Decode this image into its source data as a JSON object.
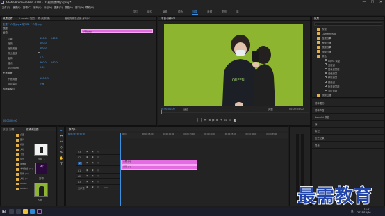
{
  "window": {
    "title": "Adobe Premiere Pro 2020 - D:\\视频\\剪辑.prproj *",
    "buttons": [
      "—",
      "□",
      "✕"
    ]
  },
  "menu": [
    "文件(F)",
    "编辑(E)",
    "剪辑(C)",
    "序列(S)",
    "标记(M)",
    "图形(G)",
    "视图(V)",
    "窗口(W)",
    "帮助(H)"
  ],
  "workspaces": [
    {
      "label": "学习",
      "active": false
    },
    {
      "label": "组件",
      "active": false
    },
    {
      "label": "编辑",
      "active": false
    },
    {
      "label": "颜色",
      "active": false
    },
    {
      "label": "效果",
      "active": true
    },
    {
      "label": "音频",
      "active": false
    },
    {
      "label": "图形",
      "active": false
    },
    {
      "label": "库",
      "active": false
    }
  ],
  "effect_controls": {
    "tabs": [
      "效果控件",
      "Lumetri 范围",
      "源:(无剪辑)",
      "音频剪辑混合器:序列01"
    ],
    "source_path": "主要 * 人物.jpg ▸ 序列01 * 人物.jpg",
    "video_header": "视频",
    "sections": [
      {
        "label": "运动",
        "bold": true
      },
      {
        "label": "位置",
        "value": "360.0",
        "value2": "240.0"
      },
      {
        "label": "缩放",
        "value": "100.0"
      },
      {
        "label": "缩放宽度",
        "value": "100.0"
      },
      {
        "label": "等比缩放",
        "checkbox": true
      },
      {
        "label": "旋转",
        "value": "0.0"
      },
      {
        "label": "锚点",
        "value": "360.0",
        "value2": "240.0"
      },
      {
        "label": "防闪烁滤镜",
        "value": "0.00"
      },
      {
        "label": "不透明度",
        "bold": true
      },
      {
        "label": "不透明度",
        "value": "100.0 %"
      },
      {
        "label": "混合模式",
        "value": "正常"
      },
      {
        "label": "时间重映射",
        "bold": true
      }
    ],
    "clip_label": "人物.jpg",
    "timecode": "00:00:00:00"
  },
  "program_monitor": {
    "title": "节目: 序列01",
    "timecode_left": "00:00:00:00",
    "fit_label": "适合",
    "quality_label": "完整",
    "timecode_right": "00:00:05:00",
    "bg_color": "#8db52f"
  },
  "effects_panel": {
    "title": "效果",
    "categories": [
      "预设",
      "Lumetri 预设",
      "音频效果",
      "音频过渡",
      "视频效果",
      "视频过渡",
      "颜色"
    ],
    "open_category_index": 6,
    "items": [
      "Alpha 调整",
      "亮度键",
      "图像遮罩键",
      "差值遮罩",
      "移除遮罩",
      "超级键",
      "轨道遮罩键",
      "非红色键"
    ],
    "more_categories": [
      "视频过渡"
    ],
    "side_sections": [
      "基本图形",
      "基本声音",
      "Lumetri 颜色",
      "库",
      "标记",
      "历史记录",
      "信息"
    ]
  },
  "project_panel": {
    "tabs": [
      "项目: 剪辑",
      "媒体浏览器"
    ],
    "tree": [
      "桌面",
      "图片",
      "视频",
      "文档",
      "下载",
      "音乐",
      "此电脑",
      "本地磁盘 (C:)",
      "软件 (D:)",
      "文档 (E:)",
      "Adobe",
      "Adobe P"
    ],
    "thumbs": [
      {
        "label": "视频_1",
        "type": "video"
      },
      {
        "label": "剪辑",
        "type": "premiere"
      },
      {
        "label": "人物",
        "type": "photo"
      }
    ]
  },
  "tools": [
    "▸",
    "⇔",
    "⇿",
    "◇",
    "✎",
    "✋",
    "T"
  ],
  "timeline": {
    "title": "序列01",
    "timecode": "00:00:00:00",
    "ruler_labels": [
      "00:00",
      "00:00:05:00",
      "00:00:10:00",
      "00:00:15:00",
      "00:00:20:00",
      "00:00:25:00",
      "00:00:30:00",
      "00:00:35:00"
    ],
    "tracks": [
      {
        "name": "V3"
      },
      {
        "name": "V2"
      },
      {
        "name": "V1",
        "active": true
      },
      {
        "name": "A1"
      },
      {
        "name": "A2"
      },
      {
        "name": "A3"
      },
      {
        "name": "主声道",
        "value": "0.0"
      }
    ],
    "clips": [
      {
        "label": "人物.jpg",
        "track": "V2"
      },
      {
        "label": "背景.jpg",
        "track": "V1"
      }
    ]
  },
  "taskbar": {
    "time": "11:11",
    "date": "2021/10/26",
    "tray": "英"
  },
  "watermark": "最需教育",
  "colors": {
    "accent": "#3d8fe0",
    "clip": "#e26ce0",
    "screen_green": "#8db52f",
    "folder": "#e2b04a"
  }
}
